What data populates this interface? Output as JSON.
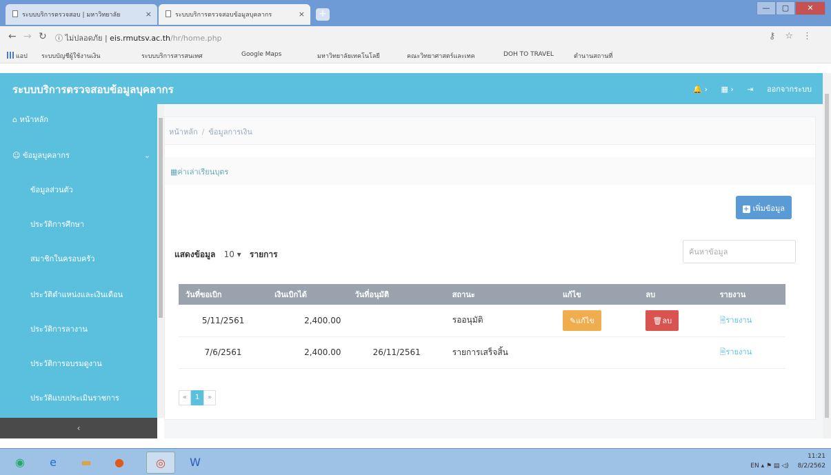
{
  "browser": {
    "tabs": [
      {
        "label": "ระบบบริการตรวจสอบ | มหาวิทยาลัย",
        "active": false
      },
      {
        "label": "ระบบบริการตรวจสอบข้อมูลบุคลากร",
        "active": true
      }
    ],
    "new_tab_label": "+",
    "window_buttons": {
      "minimize": "—",
      "maximize": "▢",
      "close": "✕"
    },
    "address": {
      "security_text": "ไม่ปลอดภัย",
      "host": "eis.rmutsv.ac.th",
      "path": "/hr/home.php"
    },
    "bookmarks": [
      "แอป",
      "ระบบบัญชีผู้ใช้งานเงิน",
      "ระบบบริการสารสนเทศ",
      "Google Maps",
      "มหาวิทยาลัยเทคโนโลยี",
      "คณะวิทยาศาสตร์และเทค",
      "DOH TO TRAVEL",
      "ตำนานสถานที่"
    ]
  },
  "app": {
    "title": "ระบบบริการตรวจสอบข้อมูลบุคลากร",
    "header_actions": {
      "logout_label": "ออกจากระบบ"
    }
  },
  "sidebar": {
    "items": [
      {
        "label": "หน้าหลัก",
        "icon": "home-icon"
      },
      {
        "label": "ข้อมูลบุคลากร",
        "icon": "user-icon"
      }
    ],
    "sub_items": [
      "ข้อมูลส่วนตัว",
      "ประวัติการศึกษา",
      "สมาชิกในครอบครัว",
      "ประวัติตำแหน่งและเงินเดือน",
      "ประวัติการลางาน",
      "ประวัติการอบรมดูงาน",
      "ประวัติแบบประเมินราชการ"
    ],
    "collapse_label": "‹"
  },
  "main": {
    "breadcrumb": {
      "home": "หน้าหลัก",
      "current": "ข้อมูลการเงิน"
    },
    "subtitle": "ค่าเล่าเรียนบุตร",
    "add_button_label": "เพิ่มข้อมูล",
    "length_control": {
      "prefix": "แสดงข้อมูล",
      "value": "10",
      "suffix": "รายการ"
    },
    "search_placeholder": "ค้นหาข้อมูล",
    "table": {
      "columns": [
        "วันที่ขอเบิก",
        "เงินเบิกได้",
        "วันที่อนุมัติ",
        "สถานะ",
        "แก้ไข",
        "ลบ",
        "รายงาน"
      ],
      "rows": [
        {
          "request_date": "5/11/2561",
          "amount": "2,400.00",
          "approve_date": "",
          "status": "รออนุมัติ",
          "edit": "แก้ไข",
          "delete": "ลบ",
          "report": "รายงาน"
        },
        {
          "request_date": "7/6/2561",
          "amount": "2,400.00",
          "approve_date": "26/11/2561",
          "status": "รายการเสร็จสิ้น",
          "edit": "",
          "delete": "",
          "report": "รายงาน"
        }
      ]
    },
    "pagination": {
      "prev": "«",
      "current": "1",
      "next": "»"
    }
  },
  "taskbar": {
    "language": "EN",
    "time": "11:21",
    "date": "8/2/2562"
  }
}
